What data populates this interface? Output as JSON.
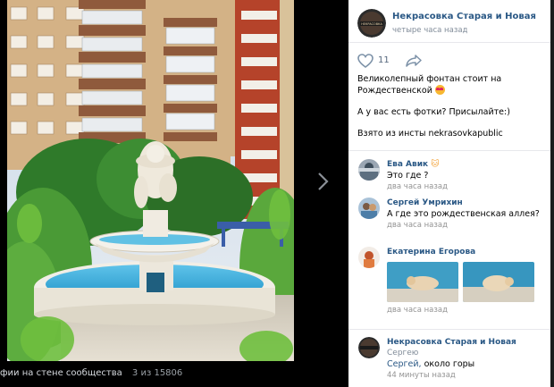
{
  "viewer": {
    "caption_album": "фии на стене сообщества",
    "caption_counter": "3 из 15806"
  },
  "post": {
    "author": "Некрасовка Старая и Новая",
    "time": "четыре часа назад",
    "likes": "11",
    "text_line1": "Великолепный фонтан стоит на",
    "text_line2": "Рождественской",
    "text_line3": "А у вас есть фотки? Присылайте:)",
    "text_line4": "Взято из инсты nekrasovkapublic",
    "avatar_text": "НЕКРАСОВКА"
  },
  "comments": [
    {
      "name": "Ева Авик",
      "text": "Это где ?",
      "time": "два часа назад"
    },
    {
      "name": "Сергей Умрихин",
      "text": "А где это рождественская аллея?",
      "time": "два часа назад"
    },
    {
      "name": "Екатерина Егорова",
      "time": "два часа назад"
    },
    {
      "name": "Некрасовка Старая и Новая",
      "reply_to": "Сергею",
      "reply_to_name": "Сергей,",
      "text": "около горы",
      "time": "44 минуты назад"
    }
  ],
  "colors": {
    "link": "#2a5885",
    "meta": "#818c99",
    "accent_water": "#2aa6d8"
  }
}
